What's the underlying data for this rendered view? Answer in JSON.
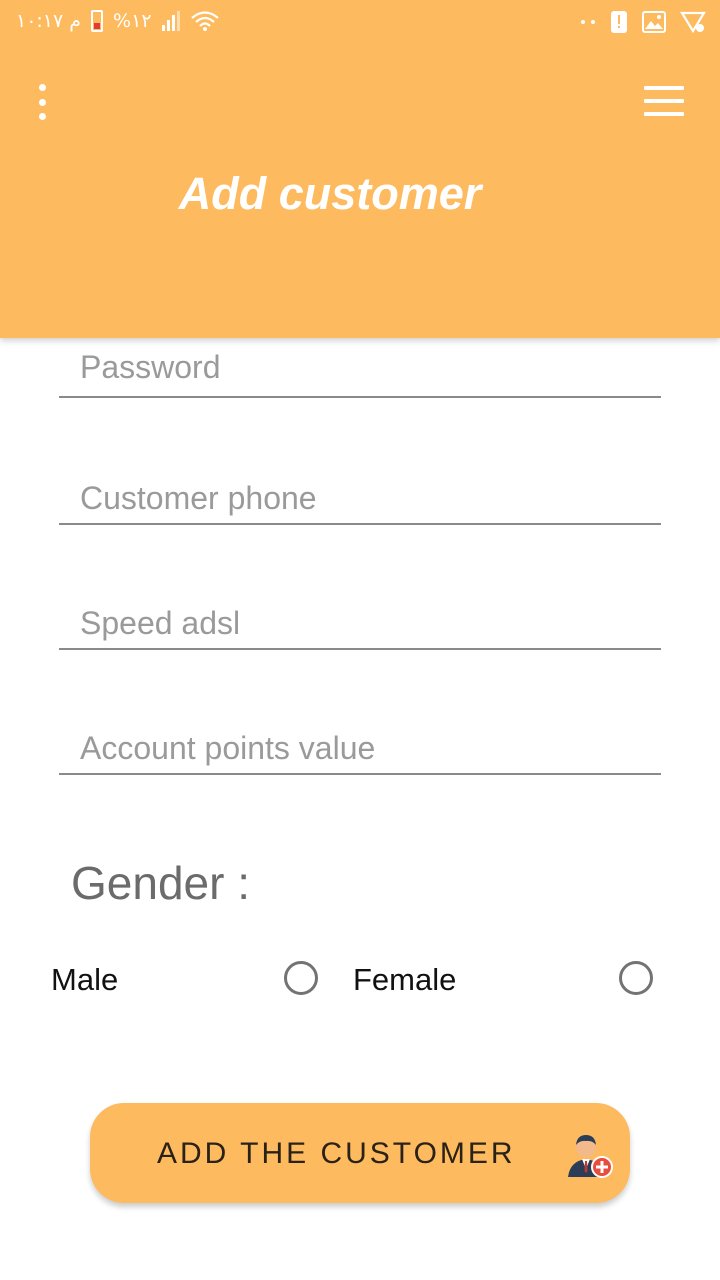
{
  "status_bar": {
    "time": "م ١٠:١٧",
    "battery": "%١٢"
  },
  "header": {
    "title": "Add customer"
  },
  "form": {
    "password_placeholder": "Password",
    "phone_placeholder": "Customer phone",
    "speed_placeholder": "Speed adsl",
    "points_placeholder": "Account points value"
  },
  "gender": {
    "label": "Gender :",
    "male_label": "Male",
    "female_label": "Female"
  },
  "actions": {
    "add_label": "ADD THE CUSTOMER"
  },
  "colors": {
    "accent": "#fdba5e",
    "underline": "#8a8a8a",
    "radio_border": "#737373"
  },
  "icons": {
    "menu": "more-vertical-icon",
    "nav": "hamburger-icon",
    "add_user": "add-user-icon"
  }
}
